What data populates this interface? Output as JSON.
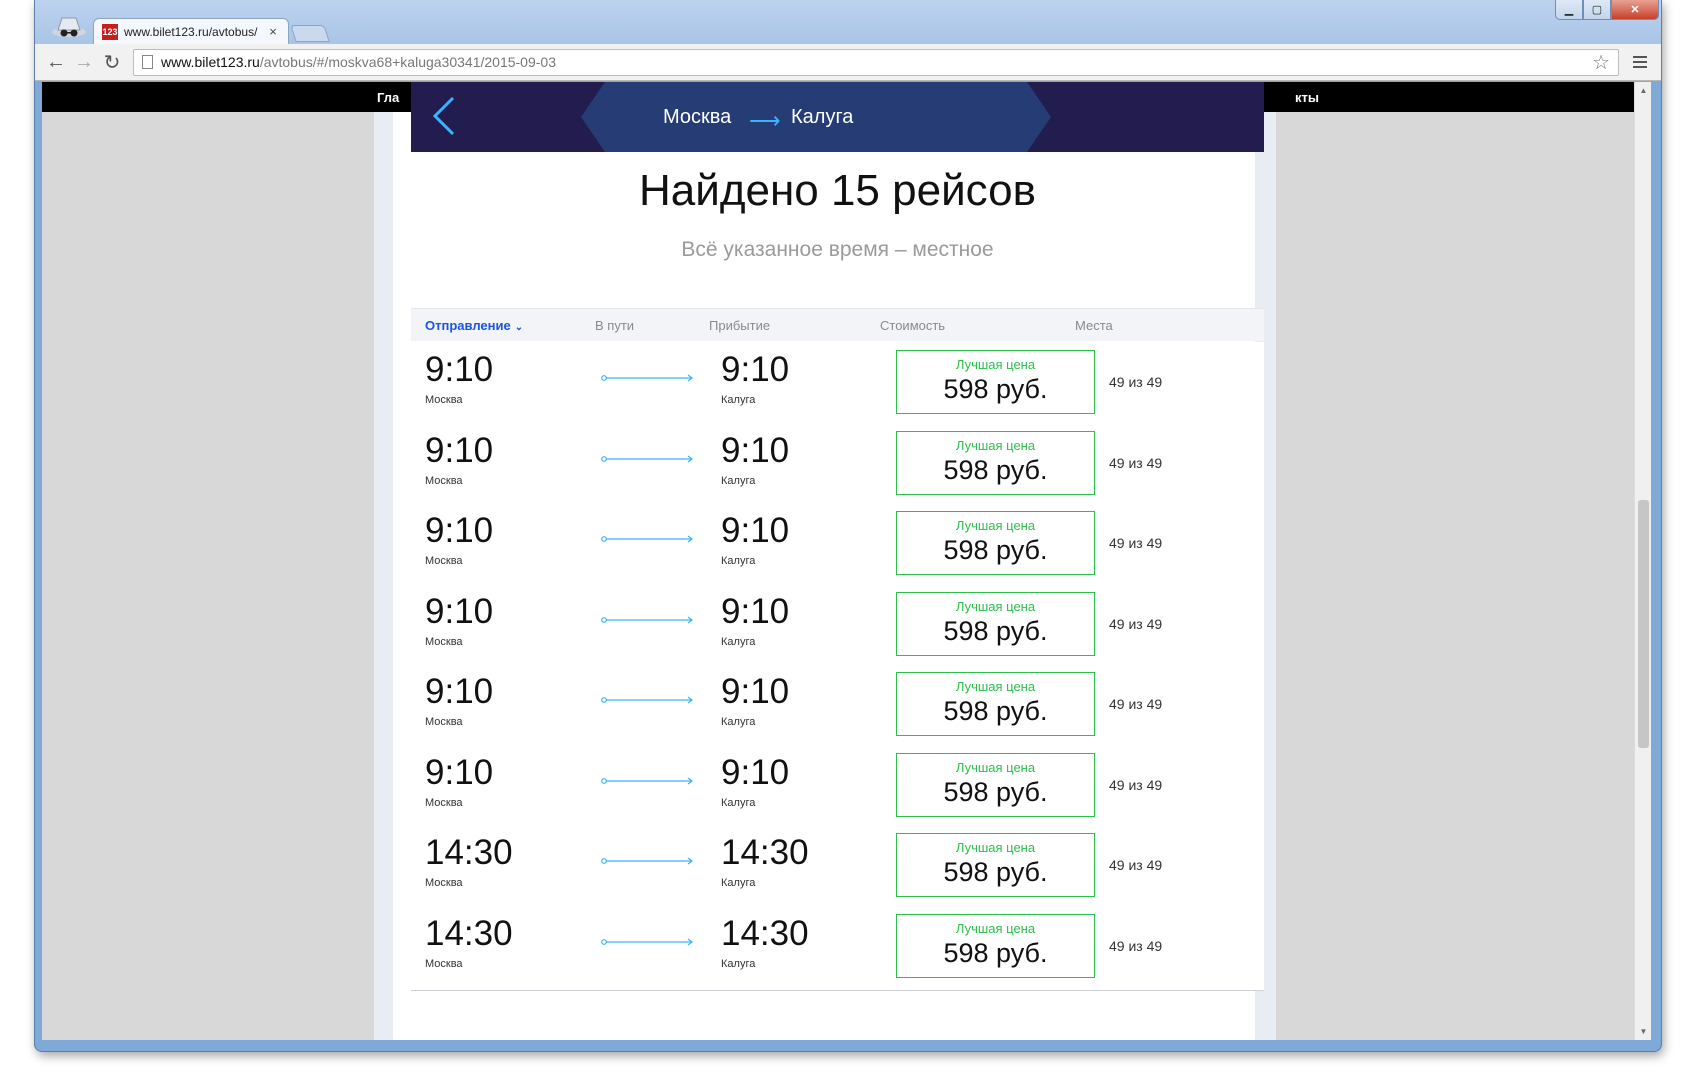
{
  "browser": {
    "tab_title": "www.bilet123.ru/avtobus/",
    "tab_close": "×",
    "favicon_text": "123",
    "url_host": "www.bilet123.ru",
    "url_path": "/avtobus/#/moskva68+kaluga30341/2015-09-03"
  },
  "site_nav": {
    "left_text": "Гла",
    "right_text": "кты"
  },
  "route": {
    "from": "Москва",
    "arrow": "⟶",
    "to": "Калуга"
  },
  "results": {
    "title": "Найдено 15 рейсов",
    "subtitle": "Всё указанное время – местное"
  },
  "table": {
    "headers": {
      "departure": "Отправление",
      "duration": "В пути",
      "arrival": "Прибытие",
      "price": "Стоимость",
      "seats": "Места"
    },
    "rows": [
      {
        "dep_time": "9:10",
        "dep_city": "Москва",
        "arr_time": "9:10",
        "arr_city": "Калуга",
        "price_label": "Лучшая цена",
        "price": "598 руб.",
        "seats": "49 из 49"
      },
      {
        "dep_time": "9:10",
        "dep_city": "Москва",
        "arr_time": "9:10",
        "arr_city": "Калуга",
        "price_label": "Лучшая цена",
        "price": "598 руб.",
        "seats": "49 из 49"
      },
      {
        "dep_time": "9:10",
        "dep_city": "Москва",
        "arr_time": "9:10",
        "arr_city": "Калуга",
        "price_label": "Лучшая цена",
        "price": "598 руб.",
        "seats": "49 из 49"
      },
      {
        "dep_time": "9:10",
        "dep_city": "Москва",
        "arr_time": "9:10",
        "arr_city": "Калуга",
        "price_label": "Лучшая цена",
        "price": "598 руб.",
        "seats": "49 из 49"
      },
      {
        "dep_time": "9:10",
        "dep_city": "Москва",
        "arr_time": "9:10",
        "arr_city": "Калуга",
        "price_label": "Лучшая цена",
        "price": "598 руб.",
        "seats": "49 из 49"
      },
      {
        "dep_time": "9:10",
        "dep_city": "Москва",
        "arr_time": "9:10",
        "arr_city": "Калуга",
        "price_label": "Лучшая цена",
        "price": "598 руб.",
        "seats": "49 из 49"
      },
      {
        "dep_time": "14:30",
        "dep_city": "Москва",
        "arr_time": "14:30",
        "arr_city": "Калуга",
        "price_label": "Лучшая цена",
        "price": "598 руб.",
        "seats": "49 из 49"
      },
      {
        "dep_time": "14:30",
        "dep_city": "Москва",
        "arr_time": "14:30",
        "arr_city": "Калуга",
        "price_label": "Лучшая цена",
        "price": "598 руб.",
        "seats": "49 из 49"
      }
    ]
  },
  "colors": {
    "route_bar": "#231c4f",
    "route_mid": "#263c75",
    "accent_blue": "#1a55e3",
    "path_line": "#38b5ff",
    "best_price_green": "#2bbf4b"
  },
  "icons": {
    "back": "chevron-left-icon",
    "incognito": "incognito-icon",
    "reload": "reload-icon",
    "star": "star-icon",
    "menu": "hamburger-menu-icon"
  }
}
